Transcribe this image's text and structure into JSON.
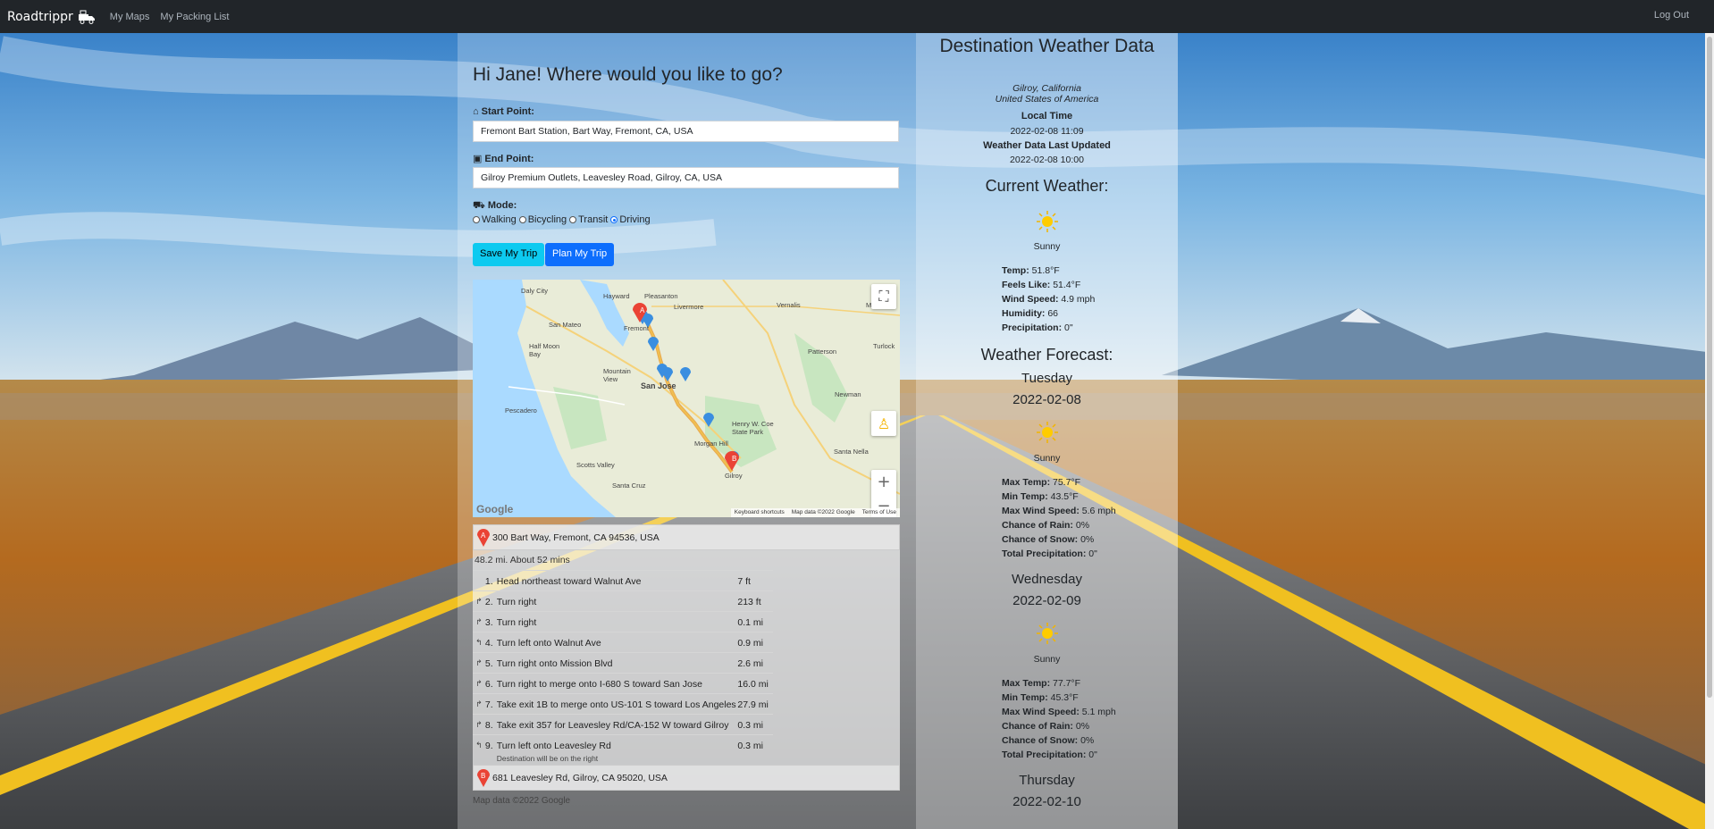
{
  "nav": {
    "brand": "Roadtrippr",
    "brand_icon": "truck-icon",
    "links": [
      "My Maps",
      "My Packing List"
    ],
    "logout": "Log Out"
  },
  "trip": {
    "greeting": "Hi Jane! Where would you like to go?",
    "start_label": "Start Point:",
    "start_icon": "home-icon",
    "start_value": "Fremont Bart Station, Bart Way, Fremont, CA, USA",
    "end_label": "End Point:",
    "end_icon": "suitcase-icon",
    "end_value": "Gilroy Premium Outlets, Leavesley Road, Gilroy, CA, USA",
    "mode_label": "Mode:",
    "mode_icon": "car-icon",
    "modes": [
      "Walking",
      "Bicycling",
      "Transit",
      "Driving"
    ],
    "selected_mode": "Driving",
    "save_button": "Save My Trip",
    "plan_button": "Plan My Trip"
  },
  "map": {
    "cities": [
      "Daly City",
      "Hayward",
      "Pleasanton",
      "San Mateo",
      "Half Moon Bay",
      "Mountain View",
      "San Jose",
      "Pescadero",
      "Morgan Hill",
      "Henry W. Coe State Park",
      "Scotts Valley",
      "Santa Cruz",
      "Gilroy",
      "Modesto",
      "Turlock",
      "Patterson",
      "Newman",
      "Santa Nella",
      "Vernalis",
      "Livermore",
      "Fremont"
    ],
    "footer": [
      "Keyboard shortcuts",
      "Map data ©2022 Google",
      "Terms of Use"
    ],
    "logo": "Google",
    "marker_a": "A",
    "marker_b": "B"
  },
  "directions": {
    "start_address": "300 Bart Way, Fremont, CA 94536, USA",
    "summary": "48.2 mi. About 52 mins",
    "steps": [
      {
        "num": "1.",
        "text": "Head northeast toward Walnut Ave",
        "dist": "7 ft",
        "arrow": ""
      },
      {
        "num": "2.",
        "text": "Turn right",
        "dist": "213 ft",
        "arrow": "↱"
      },
      {
        "num": "3.",
        "text": "Turn right",
        "dist": "0.1 mi",
        "arrow": "↱"
      },
      {
        "num": "4.",
        "text": "Turn left onto Walnut Ave",
        "dist": "0.9 mi",
        "arrow": "↰"
      },
      {
        "num": "5.",
        "text": "Turn right onto Mission Blvd",
        "dist": "2.6 mi",
        "arrow": "↱"
      },
      {
        "num": "6.",
        "text": "Turn right to merge onto I-680 S toward San Jose",
        "dist": "16.0 mi",
        "arrow": "↱"
      },
      {
        "num": "7.",
        "text": "Take exit 1B to merge onto US-101 S toward Los Angeles",
        "dist": "27.9 mi",
        "arrow": "↱"
      },
      {
        "num": "8.",
        "text": "Take exit 357 for Leavesley Rd/CA-152 W toward Gilroy",
        "dist": "0.3 mi",
        "arrow": "↱"
      },
      {
        "num": "9.",
        "text": "Turn left onto Leavesley Rd",
        "dist": "0.3 mi",
        "arrow": "↰",
        "note": "Destination will be on the right"
      }
    ],
    "end_address": "681 Leavesley Rd, Gilroy, CA 95020, USA",
    "map_data": "Map data ©2022 Google"
  },
  "weather": {
    "title": "Destination Weather Data",
    "city": "Gilroy, California",
    "country": "United States of America",
    "local_time_label": "Local Time",
    "local_time": "2022-02-08 11:09",
    "updated_label": "Weather Data Last Updated",
    "updated": "2022-02-08 10:00",
    "current_heading": "Current Weather:",
    "current": {
      "condition": "Sunny",
      "icon": "sun-icon",
      "temp_label": "Temp:",
      "temp": "51.8°F",
      "feels_label": "Feels Like:",
      "feels": "51.4°F",
      "wind_label": "Wind Speed:",
      "wind": "4.9 mph",
      "humidity_label": "Humidity:",
      "humidity": "66",
      "precip_label": "Precipitation:",
      "precip": "0\""
    },
    "forecast_heading": "Weather Forecast:",
    "labels": {
      "max_temp": "Max Temp:",
      "min_temp": "Min Temp:",
      "max_wind": "Max Wind Speed:",
      "rain": "Chance of Rain:",
      "snow": "Chance of Snow:",
      "total_precip": "Total Precipitation:"
    },
    "forecast": [
      {
        "day": "Tuesday",
        "date": "2022-02-08",
        "condition": "Sunny",
        "max_temp": "75.7°F",
        "min_temp": "43.5°F",
        "max_wind": "5.6 mph",
        "rain": "0%",
        "snow": "0%",
        "total_precip": "0\""
      },
      {
        "day": "Wednesday",
        "date": "2022-02-09",
        "condition": "Sunny",
        "max_temp": "77.7°F",
        "min_temp": "45.3°F",
        "max_wind": "5.1 mph",
        "rain": "0%",
        "snow": "0%",
        "total_precip": "0\""
      },
      {
        "day": "Thursday",
        "date": "2022-02-10"
      }
    ]
  }
}
